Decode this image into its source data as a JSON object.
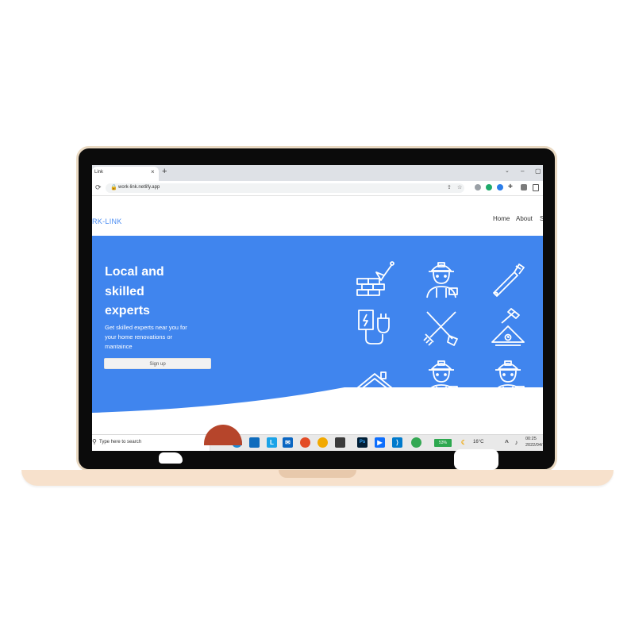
{
  "browser": {
    "tab_title": "Link",
    "tab_close": "×",
    "new_tab": "+",
    "url": "work-link.netlify.app",
    "window_minimize": "‒",
    "window_maximize": "▢"
  },
  "site": {
    "logo": "RK-LINK",
    "nav": [
      "Home",
      "About",
      "S"
    ]
  },
  "hero": {
    "title_lines": [
      "Local and",
      "skilled",
      "experts"
    ],
    "subtitle_lines": [
      "Get skilled experts near you for",
      "your home renovations or",
      "mantaince"
    ],
    "signup_label": "Sign up",
    "icons": [
      "bricklayer-icon",
      "construction-worker-icon",
      "pipe-wrench-icon",
      "electric-plug-icon",
      "shovel-rake-icon",
      "roof-hammer-icon",
      "roof-icon",
      "construction-worker-icon",
      "construction-worker-icon"
    ]
  },
  "taskbar": {
    "search_placeholder": "Type here to search",
    "battery": "53%",
    "temperature": "16°C",
    "time": "00:25",
    "date": "2022/04/"
  },
  "colors": {
    "hero_blue": "#4085ee",
    "logo_blue": "#4a8cf2",
    "laptop_base": "#f7e1cc"
  }
}
